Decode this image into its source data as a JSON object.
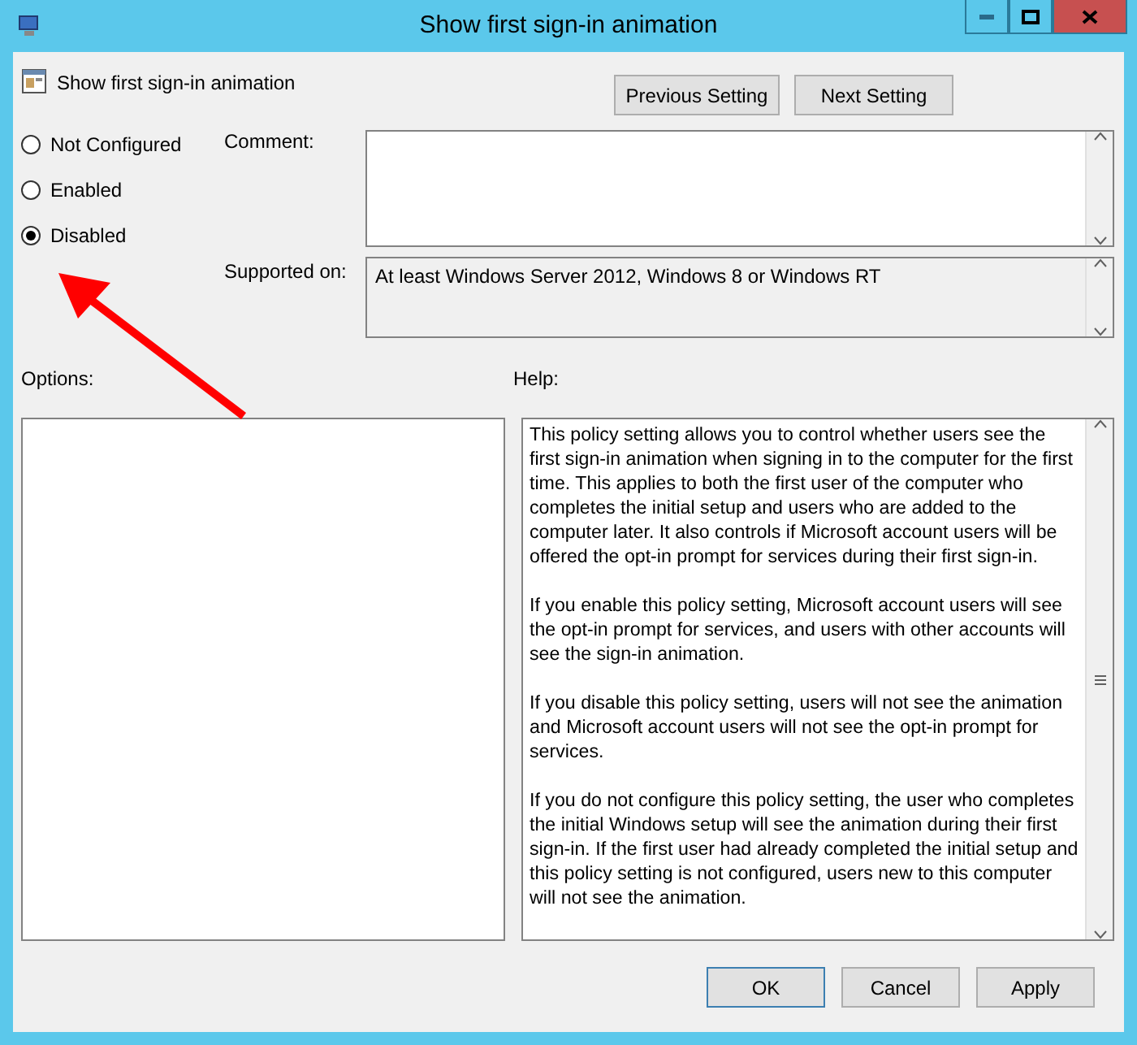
{
  "window": {
    "title": "Show first sign-in animation"
  },
  "header": {
    "policy_name": "Show first sign-in animation",
    "buttons": [
      "Previous Setting",
      "Next Setting"
    ]
  },
  "states": [
    {
      "label": "Not Configured",
      "selected": false
    },
    {
      "label": "Enabled",
      "selected": false
    },
    {
      "label": "Disabled",
      "selected": true
    }
  ],
  "comment": {
    "label": "Comment:"
  },
  "supported_on": {
    "label": "Supported on:",
    "value": "At least Windows Server 2012, Windows 8 or Windows RT"
  },
  "options": {
    "label": "Options:"
  },
  "help": {
    "label": "Help:",
    "paragraphs": [
      "This policy setting allows you to control whether users see the first sign-in animation when signing in to the computer for the first time.  This applies to both the first user of the computer who completes the initial setup and users who are added to the computer later.  It also controls if Microsoft account users will be offered the opt-in prompt for services during their first sign-in.",
      "If you enable this policy setting, Microsoft account users will see the opt-in prompt for services, and users with other accounts will see the sign-in animation.",
      "If you disable this policy setting, users will not see the animation and Microsoft account users will not see the opt-in prompt for services.",
      "If you do not configure this policy setting, the user who completes the initial Windows setup will see the animation during their first sign-in. If the first user had already completed the initial setup and this policy setting is not configured, users new to this computer will not see the animation."
    ]
  },
  "footer_buttons": [
    {
      "label": "OK",
      "default": true
    },
    {
      "label": "Cancel",
      "default": false
    },
    {
      "label": "Apply",
      "default": false
    }
  ]
}
